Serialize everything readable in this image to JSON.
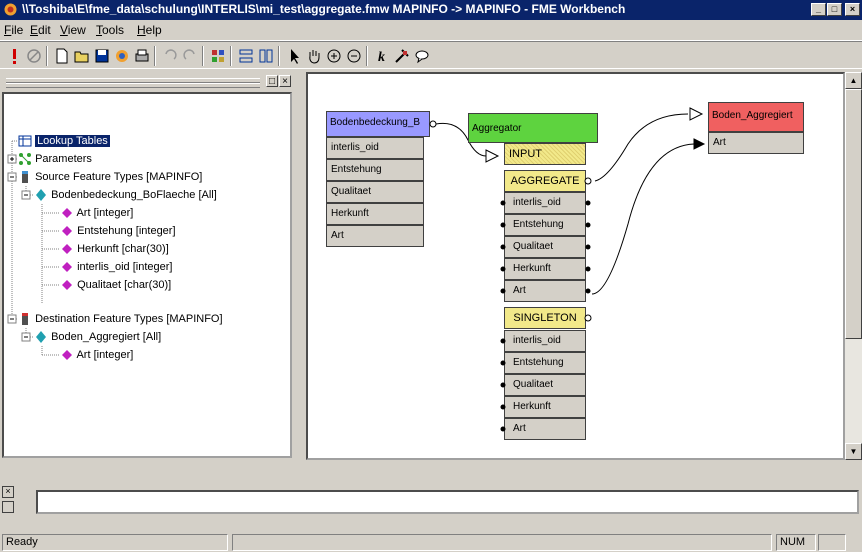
{
  "window": {
    "title": "\\\\Toshiba\\E\\fme_data\\schulung\\INTERLIS\\mi_test\\aggregate.fmw  MAPINFO -> MAPINFO - FME Workbench",
    "minimize": "_",
    "maximize": "□",
    "close": "×"
  },
  "menu": [
    {
      "label": "File",
      "u": "F",
      "rest": "ile"
    },
    {
      "label": "Edit",
      "u": "E",
      "rest": "dit"
    },
    {
      "label": "View",
      "u": "V",
      "rest": "iew"
    },
    {
      "label": "Tools",
      "u": "T",
      "rest": "ools"
    },
    {
      "label": "Help",
      "u": "H",
      "rest": "elp"
    }
  ],
  "toolbar": {
    "icons": [
      "run-icon",
      "stop-icon",
      "new-icon",
      "open-icon",
      "save-icon",
      "publish-icon",
      "print-icon",
      "undo-icon",
      "redo-icon",
      "tile-icon",
      "layout-h-icon",
      "layout-v-icon",
      "select-icon",
      "pan-icon",
      "zoom-in-icon",
      "zoom-out-icon",
      "k-icon",
      "transformer-icon",
      "comment-icon"
    ]
  },
  "tree": {
    "pane_buttons": [
      "□",
      "×"
    ],
    "items": [
      {
        "label": "Lookup Tables",
        "level": 0,
        "icon": "table-icon",
        "selected": true,
        "expander": ""
      },
      {
        "label": "Parameters",
        "level": 0,
        "icon": "parameters-icon",
        "expander": "+"
      },
      {
        "label": "Source Feature Types [MAPINFO]",
        "level": 0,
        "icon": "source-icon",
        "expander": "−"
      },
      {
        "label": "Bodenbedeckung_BoFlaeche [All]",
        "level": 1,
        "icon": "feature-type-icon",
        "expander": "−"
      },
      {
        "label": "Art [integer]",
        "level": 2,
        "icon": "attribute-icon"
      },
      {
        "label": "Entstehung [integer]",
        "level": 2,
        "icon": "attribute-icon"
      },
      {
        "label": "Herkunft [char(30)]",
        "level": 2,
        "icon": "attribute-icon"
      },
      {
        "label": "interlis_oid [integer]",
        "level": 2,
        "icon": "attribute-icon"
      },
      {
        "label": "Qualitaet [char(30)]",
        "level": 2,
        "icon": "attribute-icon"
      },
      {
        "label": "Destination Feature Types [MAPINFO]",
        "level": 0,
        "icon": "destination-icon",
        "expander": "−"
      },
      {
        "label": "Boden_Aggregiert [All]",
        "level": 1,
        "icon": "feature-type-icon",
        "expander": "−"
      },
      {
        "label": "Art [integer]",
        "level": 2,
        "icon": "attribute-icon"
      }
    ]
  },
  "canvas": {
    "source_node": {
      "title": "Bodenbedeckung_B",
      "attributes": [
        "interlis_oid",
        "Entstehung",
        "Qualitaet",
        "Herkunft",
        "Art"
      ]
    },
    "aggregator_node": {
      "title": "Aggregator",
      "input_port": "INPUT",
      "aggregate_port": "AGGREGATE",
      "aggregate_attrs": [
        "interlis_oid",
        "Entstehung",
        "Qualitaet",
        "Herkunft",
        "Art"
      ],
      "singleton_port": "SINGLETON",
      "singleton_attrs": [
        "interlis_oid",
        "Entstehung",
        "Qualitaet",
        "Herkunft",
        "Art"
      ]
    },
    "dest_node": {
      "title": "Boden_Aggregiert",
      "attributes": [
        "Art"
      ]
    }
  },
  "status": {
    "text": "Ready",
    "num": "NUM"
  },
  "colors": {
    "title_bg": "#0a246a",
    "source_header": "#9999ff",
    "aggregator_header": "#5ed33f",
    "dest_header": "#f06060",
    "port_header": "#f2e98a"
  }
}
